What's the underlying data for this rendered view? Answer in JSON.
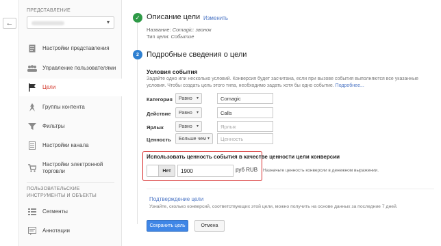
{
  "sidebar": {
    "section_view": "ПРЕДСТАВЛЕНИЕ",
    "items": [
      {
        "label": "Настройки представления",
        "icon": "document-icon"
      },
      {
        "label": "Управление пользователями",
        "icon": "users-icon"
      },
      {
        "label": "Цели",
        "icon": "flag-icon"
      },
      {
        "label": "Группы контента",
        "icon": "person-walk-icon"
      },
      {
        "label": "Фильтры",
        "icon": "filter-icon"
      },
      {
        "label": "Настройки канала",
        "icon": "funnel-doc-icon"
      },
      {
        "label": "Настройки электронной торговли",
        "icon": "cart-icon"
      }
    ],
    "section_tools": "ПОЛЬЗОВАТЕЛЬСКИЕ ИНСТРУМЕНТЫ И ОБЪЕКТЫ",
    "tools": [
      {
        "label": "Сегменты",
        "icon": "segments-icon"
      },
      {
        "label": "Аннотации",
        "icon": "annotation-icon"
      }
    ]
  },
  "step1": {
    "title": "Описание цели",
    "edit": "Изменить",
    "name_label": "Название:",
    "name_value": "Comagic: звонок",
    "type_label": "Тип цели:",
    "type_value": "Событие"
  },
  "step2": {
    "number": "2",
    "title": "Подробные сведения о цели",
    "conditions_title": "Условия события",
    "conditions_desc": "Задайте одно или несколько условий. Конверсия будет засчитана, если при вызове события выполняются все указанные условия. Чтобы создать цель этого типа, необходимо задать хотя бы одно событие.",
    "more_link": "Подробнее...",
    "rows": [
      {
        "label": "Категория",
        "cmp": "Равно",
        "value": "Comagic",
        "placeholder": ""
      },
      {
        "label": "Действие",
        "cmp": "Равно",
        "value": "Calls",
        "placeholder": ""
      },
      {
        "label": "Ярлык",
        "cmp": "Равно",
        "value": "",
        "placeholder": "Ярлык"
      },
      {
        "label": "Ценность",
        "cmp": "Больше чем",
        "value": "",
        "placeholder": "Ценность"
      }
    ],
    "use_value_label": "Использовать ценность события в качестве ценности цели конверсии",
    "toggle_label": "Нет",
    "amount": "1900",
    "currency": "руб RUB",
    "currency_hint": "Назначьте ценность конверсии в денежном выражении.",
    "verify_link": "Подтверждение цели",
    "verify_desc": "Узнайте, сколько конверсий, соответствующих этой цели, можно получить на основе данных за последние 7 дней."
  },
  "buttons": {
    "save": "Сохранить цель",
    "cancel": "Отмена"
  },
  "colors": {
    "accent_blue": "#3f86e6",
    "success_green": "#2e9a47",
    "active_red": "#d43a2e",
    "highlight_red": "#d62b2b",
    "link_blue": "#4a74c4"
  }
}
